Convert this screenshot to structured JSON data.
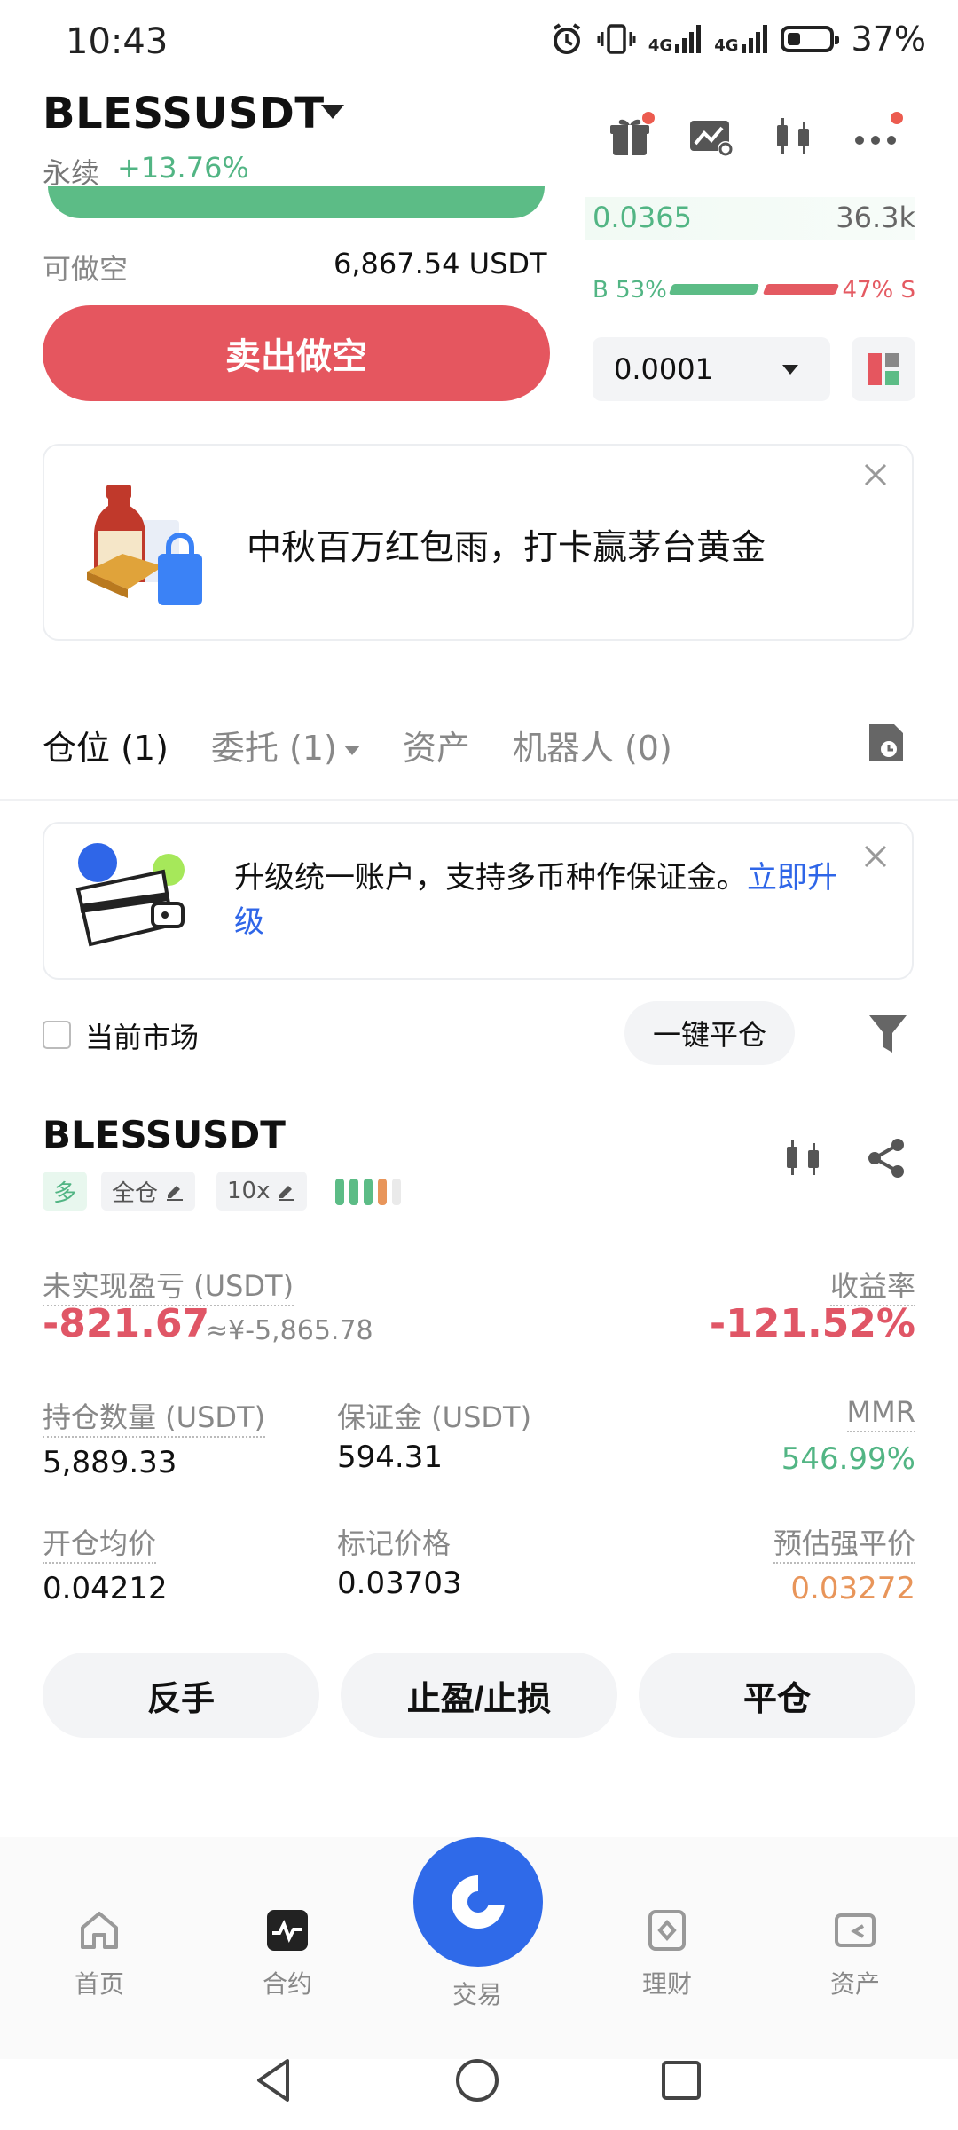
{
  "status_bar": {
    "time": "10:43",
    "network_1": "4G",
    "network_2": "4G",
    "battery": "37%"
  },
  "header": {
    "pair": "BLESSUSDT",
    "contract_type": "永续",
    "change": "+13.76%"
  },
  "order_book": {
    "price": "0.0365",
    "quantity": "36.3k",
    "buy_ratio": "B 53%",
    "sell_ratio": "47% S",
    "buy_ratio_value": 0.53,
    "depth_precision": "0.0001"
  },
  "order_form": {
    "available_short_label": "可做空",
    "available_short_value": "6,867.54 USDT",
    "sell_button": "卖出做空"
  },
  "promo": {
    "text": "中秋百万红包雨，打卡赢茅台黄金"
  },
  "tabs": [
    {
      "label": "仓位 (1)",
      "active": true
    },
    {
      "label": "委托 (1)",
      "active": false
    },
    {
      "label": "资产",
      "active": false
    },
    {
      "label": "机器人 (0)",
      "active": false
    }
  ],
  "upgrade_banner": {
    "text": "升级统一账户，支持多币种作保证金。",
    "link": "立即升级"
  },
  "filters": {
    "current_market": "当前市场",
    "close_all": "一键平仓"
  },
  "position": {
    "symbol": "BLESSUSDT",
    "side": "多",
    "margin_mode": "全仓",
    "leverage": "10x",
    "unrealized_pnl_label": "未实现盈亏 (USDT)",
    "unrealized_pnl": "-821.67",
    "unrealized_pnl_cny": "≈¥-5,865.78",
    "roe_label": "收益率",
    "roe": "-121.52%",
    "size_label": "持仓数量 (USDT)",
    "size": "5,889.33",
    "margin_label": "保证金 (USDT)",
    "margin": "594.31",
    "mmr_label": "MMR",
    "mmr": "546.99%",
    "entry_label": "开仓均价",
    "entry": "0.04212",
    "mark_label": "标记价格",
    "mark": "0.03703",
    "liq_label": "预估强平价",
    "liq": "0.03272",
    "colors": {
      "loss": "#e05666",
      "profit": "#52b584",
      "warn": "#e8955a"
    }
  },
  "position_actions": {
    "reverse": "反手",
    "tpsl": "止盈/止损",
    "close": "平仓"
  },
  "bottom_nav": [
    {
      "label": "首页",
      "icon": "home-icon"
    },
    {
      "label": "合约",
      "icon": "futures-icon",
      "active": true
    },
    {
      "label": "交易",
      "icon": "trade-icon"
    },
    {
      "label": "理财",
      "icon": "earn-icon"
    },
    {
      "label": "资产",
      "icon": "wallet-icon"
    }
  ]
}
